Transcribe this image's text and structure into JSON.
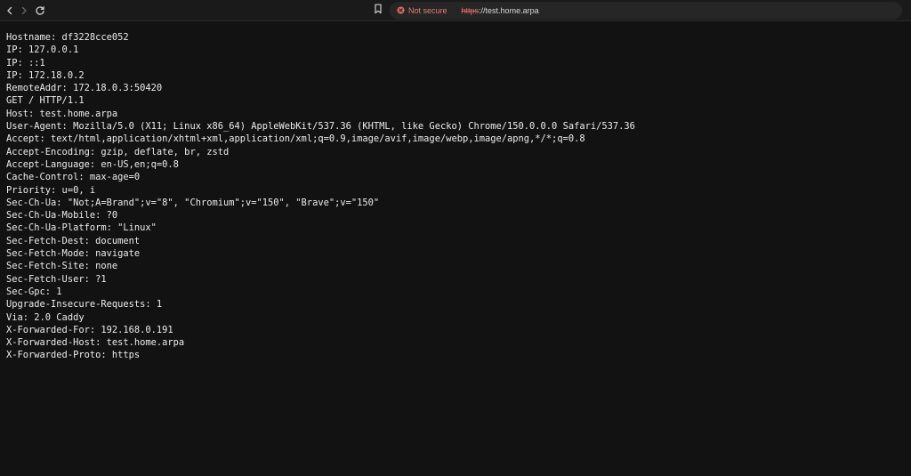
{
  "browser": {
    "security_label": "Not secure",
    "url_scheme": "https",
    "url_rest": "://test.home.arpa",
    "icons": {
      "back": "back-arrow-icon",
      "forward": "forward-arrow-icon",
      "reload": "reload-icon",
      "bookmark": "bookmark-icon",
      "security": "not-secure-warning-icon"
    },
    "colors": {
      "toolbar_bg": "#1a1a1a",
      "omnibox_bg": "#262626",
      "warning_red": "#e06a6a",
      "page_bg": "#121212"
    }
  },
  "page": {
    "lines": [
      "Hostname: df3228cce052",
      "IP: 127.0.0.1",
      "IP: ::1",
      "IP: 172.18.0.2",
      "RemoteAddr: 172.18.0.3:50420",
      "GET / HTTP/1.1",
      "Host: test.home.arpa",
      "User-Agent: Mozilla/5.0 (X11; Linux x86_64) AppleWebKit/537.36 (KHTML, like Gecko) Chrome/150.0.0.0 Safari/537.36",
      "Accept: text/html,application/xhtml+xml,application/xml;q=0.9,image/avif,image/webp,image/apng,*/*;q=0.8",
      "Accept-Encoding: gzip, deflate, br, zstd",
      "Accept-Language: en-US,en;q=0.8",
      "Cache-Control: max-age=0",
      "Priority: u=0, i",
      "Sec-Ch-Ua: \"Not;A=Brand\";v=\"8\", \"Chromium\";v=\"150\", \"Brave\";v=\"150\"",
      "Sec-Ch-Ua-Mobile: ?0",
      "Sec-Ch-Ua-Platform: \"Linux\"",
      "Sec-Fetch-Dest: document",
      "Sec-Fetch-Mode: navigate",
      "Sec-Fetch-Site: none",
      "Sec-Fetch-User: ?1",
      "Sec-Gpc: 1",
      "Upgrade-Insecure-Requests: 1",
      "Via: 2.0 Caddy",
      "X-Forwarded-For: 192.168.0.191",
      "X-Forwarded-Host: test.home.arpa",
      "X-Forwarded-Proto: https"
    ]
  }
}
